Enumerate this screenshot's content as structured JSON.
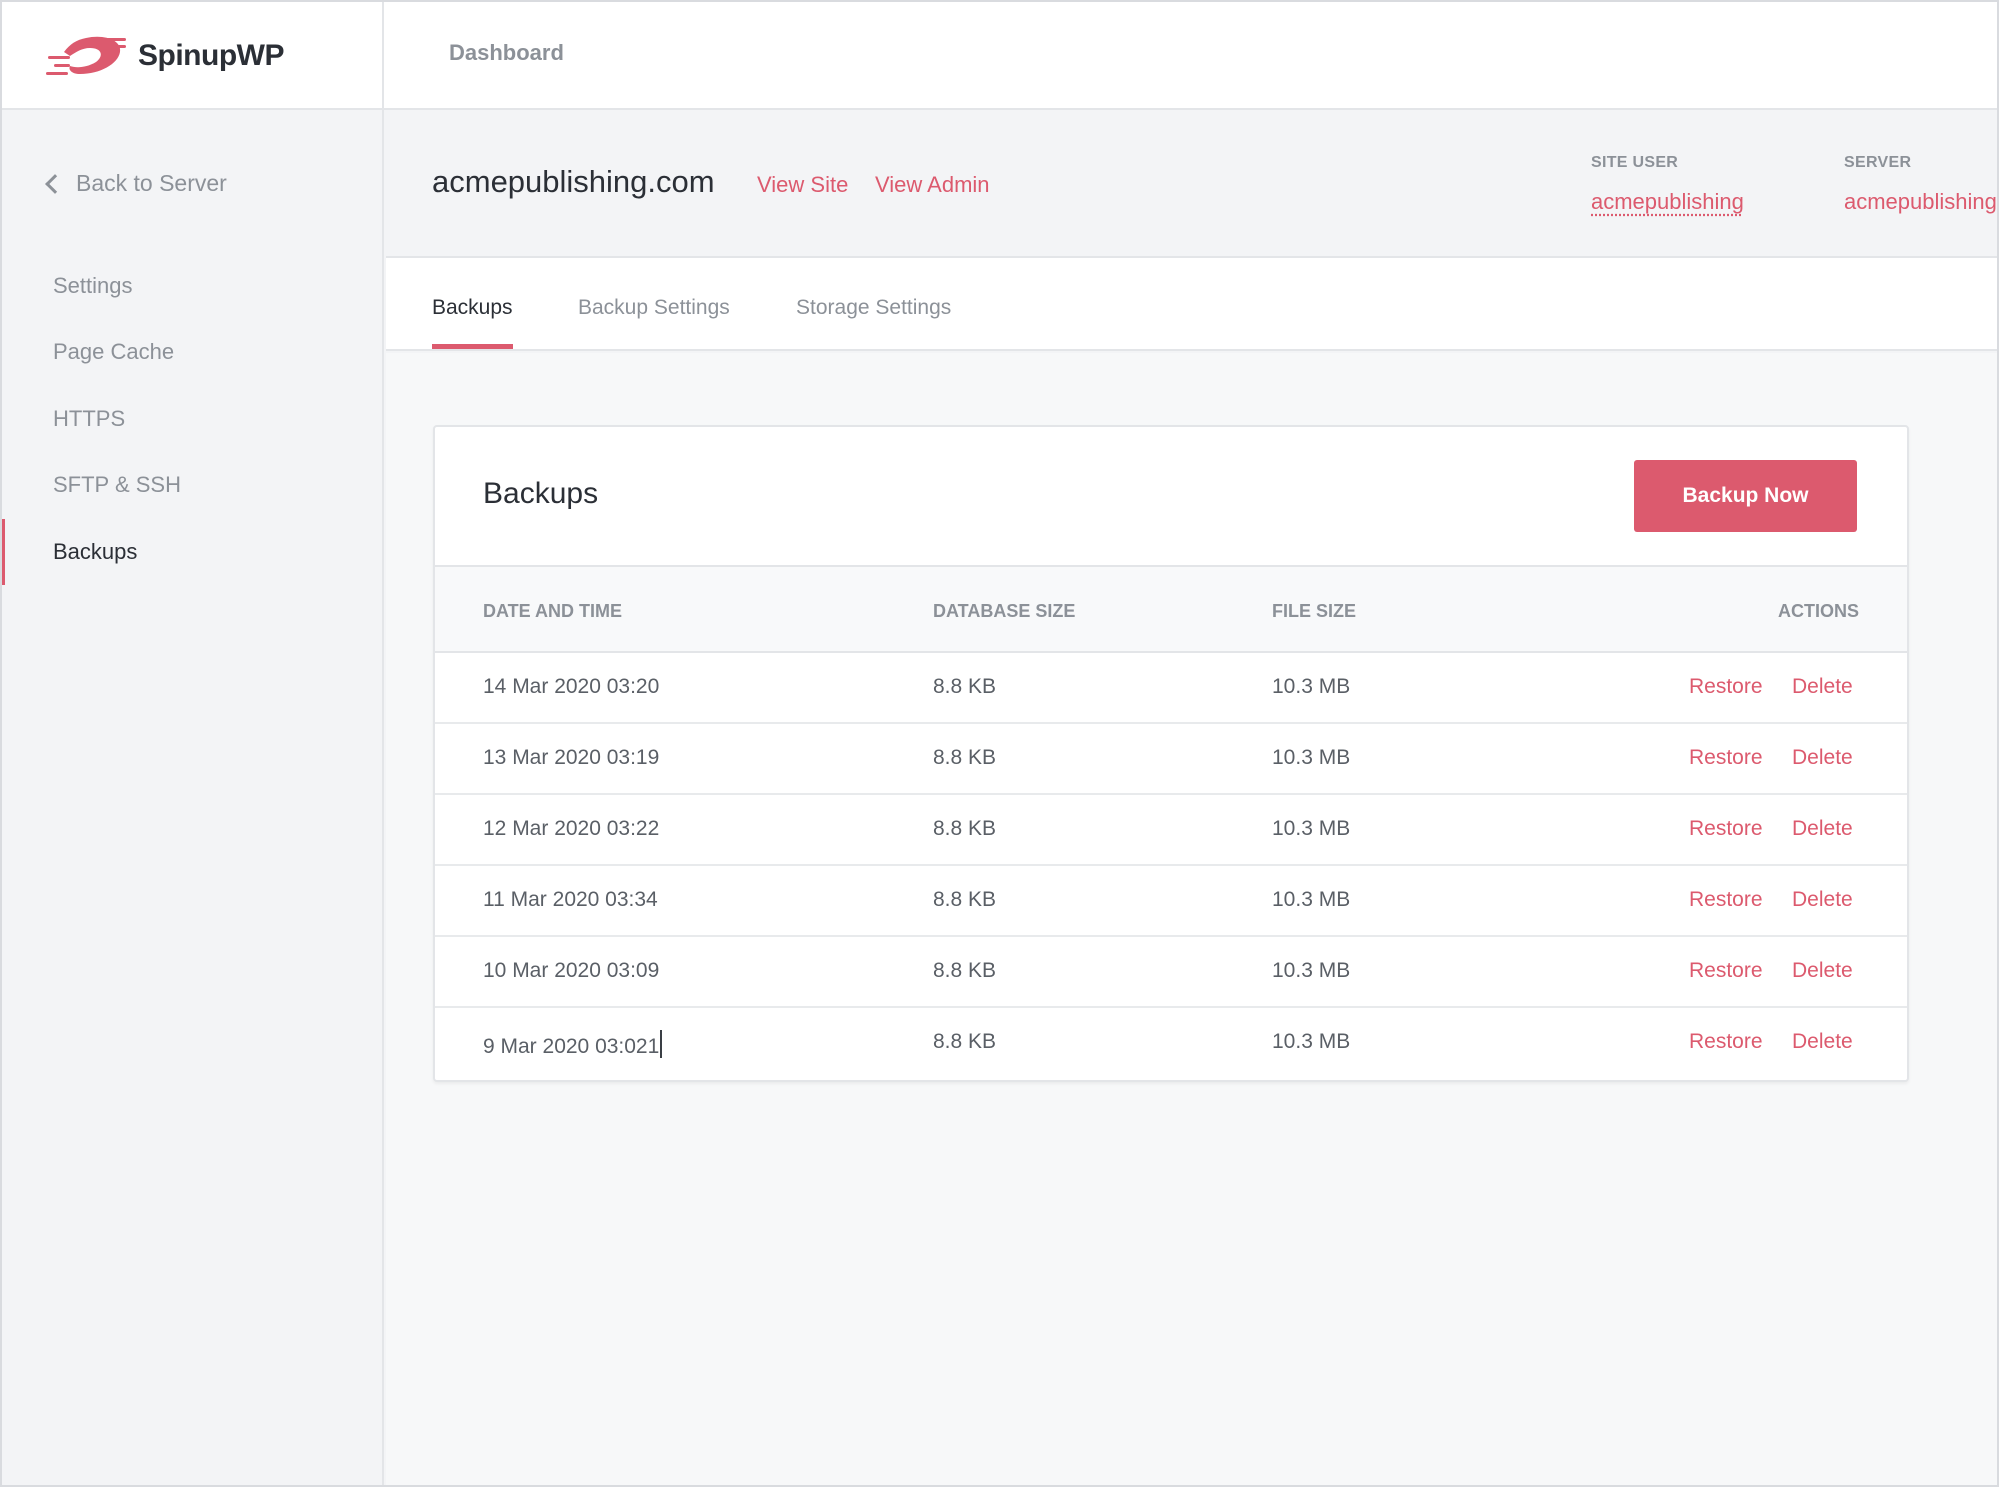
{
  "app": {
    "name": "SpinupWP",
    "brand_color": "#dc5a6e"
  },
  "topnav": {
    "dashboard": "Dashboard"
  },
  "sidebar": {
    "back_label": "Back to Server",
    "items": [
      {
        "label": "Settings",
        "active": false
      },
      {
        "label": "Page Cache",
        "active": false
      },
      {
        "label": "HTTPS",
        "active": false
      },
      {
        "label": "SFTP & SSH",
        "active": false
      },
      {
        "label": "Backups",
        "active": true
      }
    ]
  },
  "site": {
    "domain": "acmepublishing.com",
    "view_site": "View Site",
    "view_admin": "View Admin",
    "site_user_label": "SITE USER",
    "site_user": "acmepublishing",
    "server_label": "SERVER",
    "server": "acmepublishing"
  },
  "tabs": [
    {
      "label": "Backups",
      "active": true
    },
    {
      "label": "Backup Settings",
      "active": false
    },
    {
      "label": "Storage Settings",
      "active": false
    }
  ],
  "backups": {
    "title": "Backups",
    "backup_now": "Backup Now",
    "columns": [
      "DATE AND TIME",
      "DATABASE SIZE",
      "FILE SIZE",
      "ACTIONS"
    ],
    "rows": [
      {
        "date": "14 Mar 2020 03:20",
        "db_size": "8.8 KB",
        "file_size": "10.3 MB",
        "restore": "Restore",
        "delete": "Delete"
      },
      {
        "date": "13 Mar 2020 03:19",
        "db_size": "8.8 KB",
        "file_size": "10.3 MB",
        "restore": "Restore",
        "delete": "Delete"
      },
      {
        "date": "12 Mar 2020 03:22",
        "db_size": "8.8 KB",
        "file_size": "10.3 MB",
        "restore": "Restore",
        "delete": "Delete"
      },
      {
        "date": "11 Mar 2020 03:34",
        "db_size": "8.8 KB",
        "file_size": "10.3 MB",
        "restore": "Restore",
        "delete": "Delete"
      },
      {
        "date": "10 Mar 2020 03:09",
        "db_size": "8.8 KB",
        "file_size": "10.3 MB",
        "restore": "Restore",
        "delete": "Delete"
      },
      {
        "date": "9 Mar 2020 03:021",
        "db_size": "8.8 KB",
        "file_size": "10.3 MB",
        "restore": "Restore",
        "delete": "Delete"
      }
    ]
  },
  "icons": {
    "logo": "spinupwp-logo-icon",
    "back": "chevron-left-icon"
  }
}
